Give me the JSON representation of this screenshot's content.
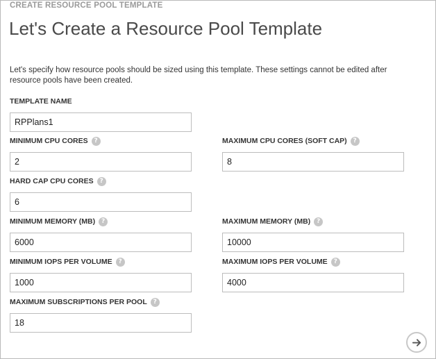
{
  "header": {
    "eyebrow": "CREATE RESOURCE POOL TEMPLATE",
    "title": "Let's Create a Resource Pool Template"
  },
  "intro_text": "Let's specify how resource pools should be sized using this template. These settings cannot be edited after resource pools have been created.",
  "fields": {
    "template_name": {
      "label": "TEMPLATE NAME",
      "value": "RPPlans1"
    },
    "min_cpu": {
      "label": "MINIMUM CPU CORES",
      "value": "2"
    },
    "max_cpu": {
      "label": "MAXIMUM CPU CORES (SOFT CAP)",
      "value": "8"
    },
    "hard_cap_cpu": {
      "label": "HARD CAP CPU CORES",
      "value": "6"
    },
    "min_memory": {
      "label": "MINIMUM MEMORY (MB)",
      "value": "6000"
    },
    "max_memory": {
      "label": "MAXIMUM MEMORY (MB)",
      "value": "10000"
    },
    "min_iops": {
      "label": "MINIMUM IOPS PER VOLUME",
      "value": "1000"
    },
    "max_iops": {
      "label": "MAXIMUM IOPS PER VOLUME",
      "value": "4000"
    },
    "max_subscriptions": {
      "label": "MAXIMUM SUBSCRIPTIONS PER POOL",
      "value": "18"
    }
  },
  "help_glyph": "?",
  "icons": {
    "help": "question-mark-icon",
    "next": "arrow-right-icon"
  },
  "colors": {
    "label": "#333333",
    "title": "#4a4a4a",
    "eyebrow": "#9a9a9a",
    "help_circle": "#c6c6c6",
    "input_border": "#bcbcbc",
    "next_border": "#c8c8c8"
  }
}
